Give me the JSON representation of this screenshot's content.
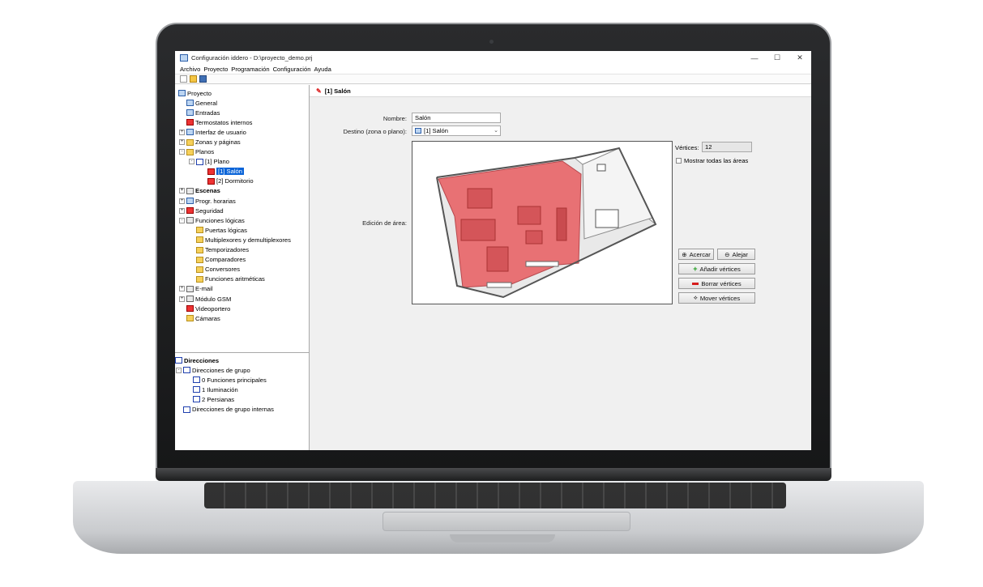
{
  "window": {
    "title": "Configuración iddero - D:\\proyecto_demo.prj",
    "minimize": "—",
    "maximize": "☐",
    "close": "✕"
  },
  "menu": [
    "Archivo",
    "Proyecto",
    "Programación",
    "Configuración",
    "Ayuda"
  ],
  "tree": {
    "root": "Proyecto",
    "items": [
      {
        "label": "General",
        "icon": "general-icon"
      },
      {
        "label": "Entradas",
        "icon": "inputs-icon"
      },
      {
        "label": "Termostatos internos",
        "icon": "thermostat-icon"
      },
      {
        "label": "Interfaz de usuario",
        "icon": "ui-icon"
      },
      {
        "label": "Zonas y páginas",
        "icon": "zones-icon"
      },
      {
        "label": "Planos",
        "icon": "folder-icon"
      },
      {
        "label": "[1] Plano",
        "icon": "plan-icon"
      },
      {
        "label": "[1] Salón",
        "icon": "area-icon",
        "selected": true
      },
      {
        "label": "[2] Dormitorio",
        "icon": "area-icon"
      },
      {
        "label": "Escenas",
        "icon": "scenes-icon"
      },
      {
        "label": "Progr. horarias",
        "icon": "schedule-icon"
      },
      {
        "label": "Seguridad",
        "icon": "security-icon"
      },
      {
        "label": "Funciones lógicas",
        "icon": "logic-icon"
      },
      {
        "label": "Puertas lógicas",
        "icon": "folder-icon"
      },
      {
        "label": "Multiplexores y demultiplexores",
        "icon": "folder-icon"
      },
      {
        "label": "Temporizadores",
        "icon": "folder-icon"
      },
      {
        "label": "Comparadores",
        "icon": "folder-icon"
      },
      {
        "label": "Conversores",
        "icon": "folder-icon"
      },
      {
        "label": "Funciones aritméticas",
        "icon": "folder-icon"
      },
      {
        "label": "E-mail",
        "icon": "email-icon"
      },
      {
        "label": "Módulo GSM",
        "icon": "gsm-icon"
      },
      {
        "label": "Videoportero",
        "icon": "intercom-icon"
      },
      {
        "label": "Cámaras",
        "icon": "camera-icon"
      }
    ]
  },
  "addresses": {
    "root": "Direcciones",
    "items": [
      {
        "label": "Direcciones de grupo"
      },
      {
        "label": "0 Funciones principales"
      },
      {
        "label": "1 Iluminación"
      },
      {
        "label": "2 Persianas"
      },
      {
        "label": "Direcciones de grupo internas"
      }
    ]
  },
  "panel": {
    "header": "[1] Salón",
    "name_label": "Nombre:",
    "name_value": "Salón",
    "dest_label": "Destino (zona o plano):",
    "dest_value": "[1] Salón",
    "area_label": "Edición de área:",
    "vertices_label": "Vértices:",
    "vertices_value": "12",
    "show_all_label": "Mostrar todas las áreas",
    "zoom_in": "Acercar",
    "zoom_out": "Alejar",
    "add_vertices": "Añadir vértices",
    "delete_vertices": "Borrar vértices",
    "move_vertices": "Mover vértices"
  },
  "colors": {
    "selection": "#0a64d8",
    "area_highlight": "#e8676b"
  }
}
